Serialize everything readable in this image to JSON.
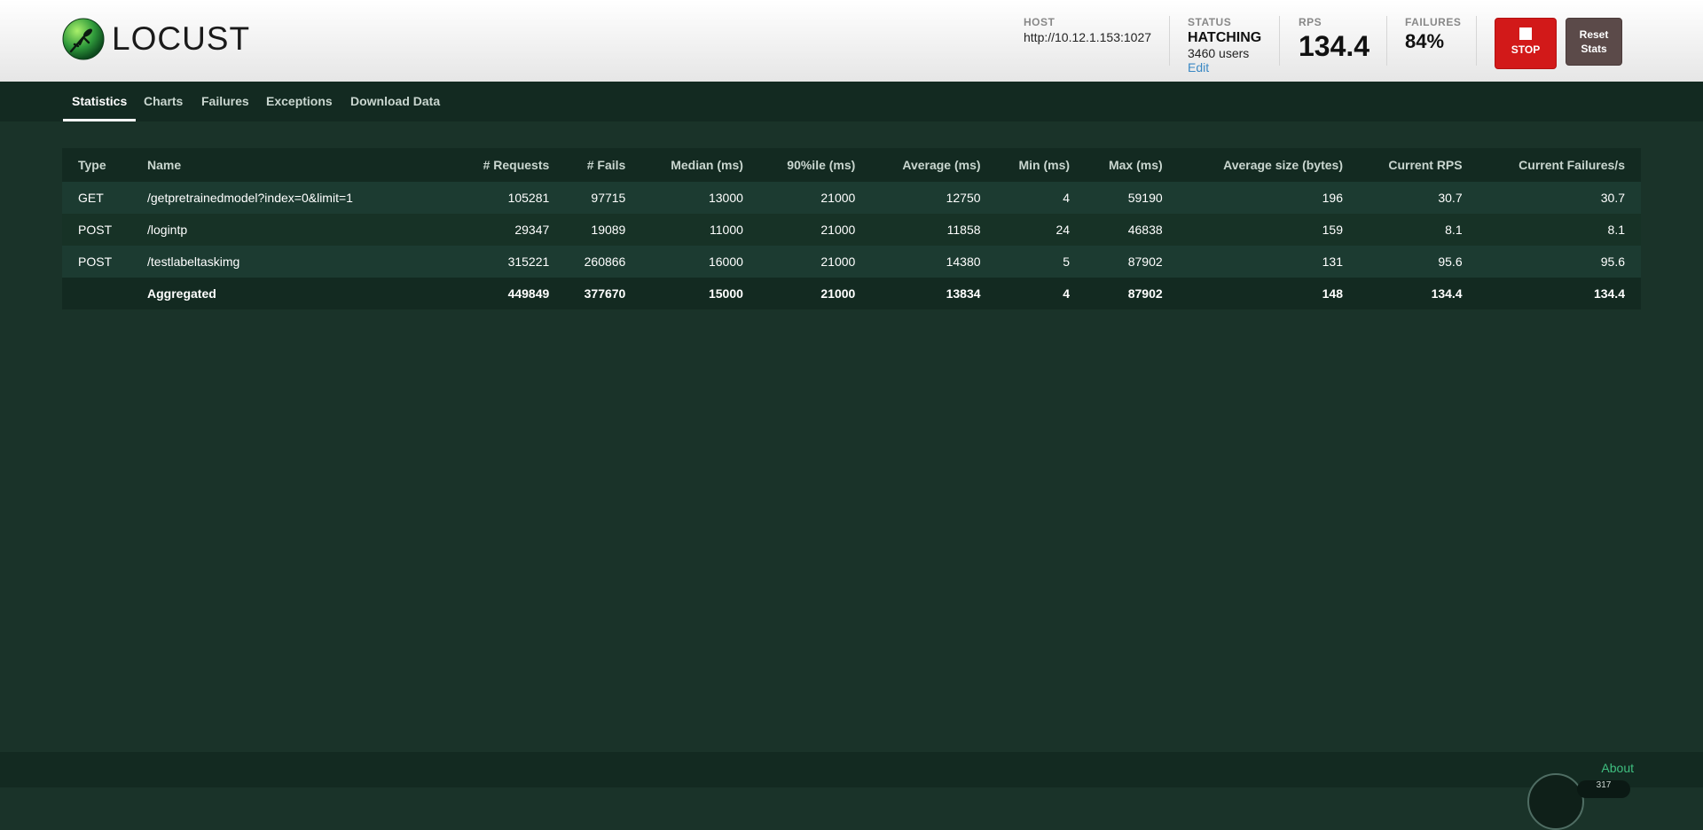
{
  "app": {
    "logo_text": "LOCUST"
  },
  "header": {
    "host_label": "HOST",
    "host_value": "http://10.12.1.153:1027",
    "status_label": "STATUS",
    "status_value": "HATCHING",
    "status_users": "3460 users",
    "status_edit": "Edit",
    "rps_label": "RPS",
    "rps_value": "134.4",
    "failures_label": "FAILURES",
    "failures_value": "84%",
    "stop_label": "STOP",
    "reset_line1": "Reset",
    "reset_line2": "Stats"
  },
  "nav": {
    "tabs": [
      {
        "label": "Statistics",
        "active": true
      },
      {
        "label": "Charts"
      },
      {
        "label": "Failures"
      },
      {
        "label": "Exceptions"
      },
      {
        "label": "Download Data"
      }
    ]
  },
  "stats": {
    "columns": [
      "Type",
      "Name",
      "# Requests",
      "# Fails",
      "Median (ms)",
      "90%ile (ms)",
      "Average (ms)",
      "Min (ms)",
      "Max (ms)",
      "Average size (bytes)",
      "Current RPS",
      "Current Failures/s"
    ],
    "rows": [
      [
        "GET",
        "/getpretrainedmodel?index=0&limit=1",
        "105281",
        "97715",
        "13000",
        "21000",
        "12750",
        "4",
        "59190",
        "196",
        "30.7",
        "30.7"
      ],
      [
        "POST",
        "/logintp",
        "29347",
        "19089",
        "11000",
        "21000",
        "11858",
        "24",
        "46838",
        "159",
        "8.1",
        "8.1"
      ],
      [
        "POST",
        "/testlabeltaskimg",
        "315221",
        "260866",
        "16000",
        "21000",
        "14380",
        "5",
        "87902",
        "131",
        "95.6",
        "95.6"
      ]
    ],
    "total": [
      "",
      "Aggregated",
      "449849",
      "377670",
      "15000",
      "21000",
      "13834",
      "4",
      "87902",
      "148",
      "134.4",
      "134.4"
    ]
  },
  "footer": {
    "about": "About",
    "gauge_text": "317"
  },
  "colors": {
    "accent": "#3fbf80",
    "stop": "#d21919",
    "reset": "#5b4a49",
    "background": "#1a3329"
  }
}
